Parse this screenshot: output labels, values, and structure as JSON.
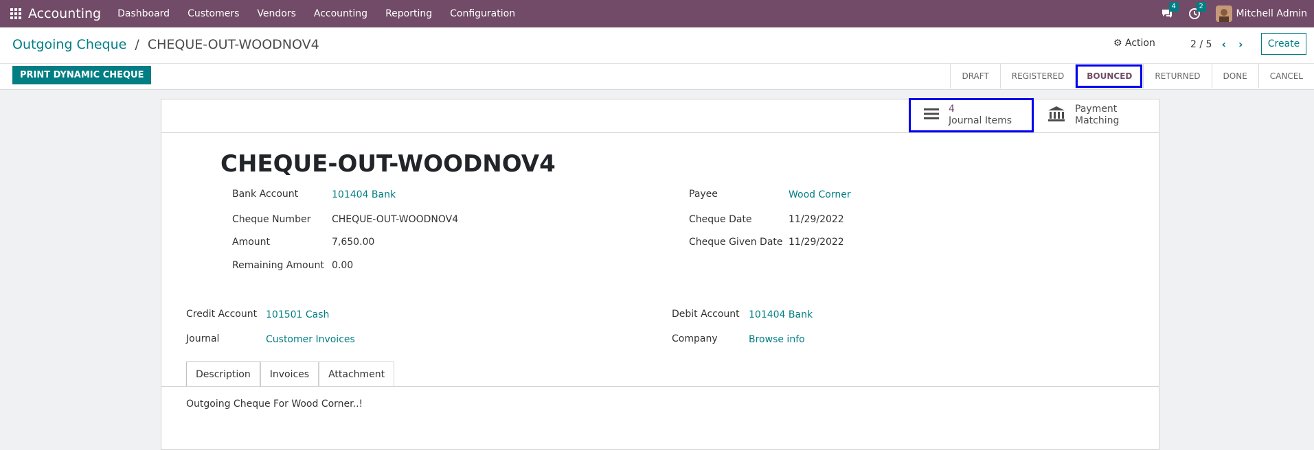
{
  "nav": {
    "app_name": "Accounting",
    "menu": [
      "Dashboard",
      "Customers",
      "Vendors",
      "Accounting",
      "Reporting",
      "Configuration"
    ],
    "chat_count": "4",
    "activity_count": "2",
    "user_name": "Mitchell Admin"
  },
  "control": {
    "breadcrumb_parent": "Outgoing Cheque",
    "breadcrumb_sep": "/",
    "breadcrumb_current": "CHEQUE-OUT-WOODNOV4",
    "action_label": "Action",
    "pager": "2 / 5",
    "create_label": "Create",
    "print_label": "PRINT DYNAMIC CHEQUE",
    "statuses": [
      "DRAFT",
      "REGISTERED",
      "BOUNCED",
      "RETURNED",
      "DONE",
      "CANCEL"
    ],
    "active_status": "BOUNCED"
  },
  "smart_buttons": {
    "journal_count": "4",
    "journal_label": "Journal Items",
    "payment_line1": "Payment",
    "payment_line2": "Matching"
  },
  "record": {
    "title": "CHEQUE-OUT-WOODNOV4",
    "bank_account_label": "Bank Account",
    "bank_account": "101404 Bank",
    "cheque_number_label": "Cheque Number",
    "cheque_number": "CHEQUE-OUT-WOODNOV4",
    "amount_label": "Amount",
    "amount": "7,650.00",
    "remaining_label": "Remaining Amount",
    "remaining": "0.00",
    "payee_label": "Payee",
    "payee": "Wood Corner",
    "cheque_date_label": "Cheque Date",
    "cheque_date": "11/29/2022",
    "given_date_label": "Cheque Given Date",
    "given_date": "11/29/2022",
    "credit_account_label": "Credit Account",
    "credit_account": "101501 Cash",
    "journal_label": "Journal",
    "journal": "Customer Invoices",
    "debit_account_label": "Debit Account",
    "debit_account": "101404 Bank",
    "company_label": "Company",
    "company": "Browse info"
  },
  "tabs": [
    "Description",
    "Invoices",
    "Attachment"
  ],
  "description": "Outgoing Cheque For Wood Corner..!"
}
